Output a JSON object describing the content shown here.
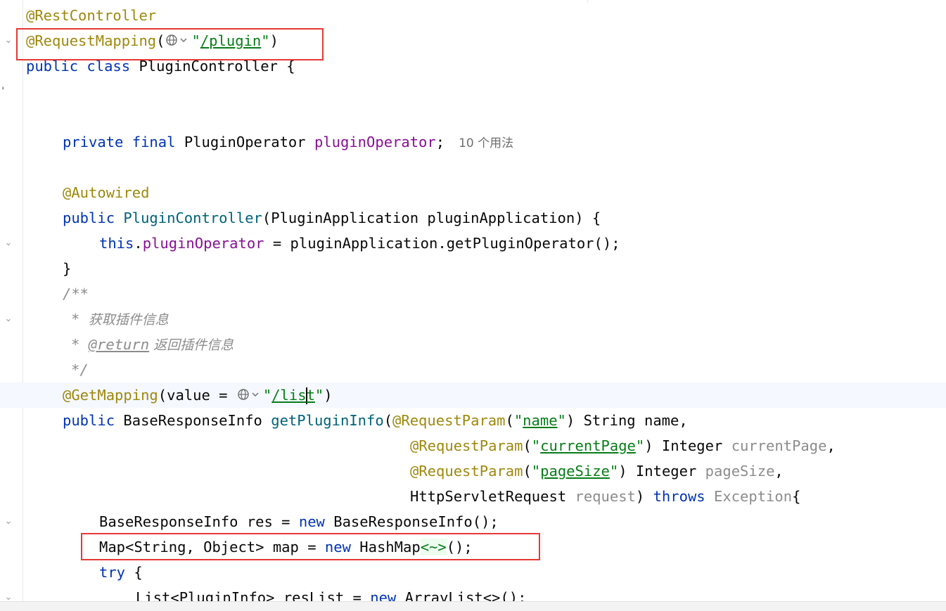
{
  "editor": {
    "inlay_hint_usages": "10 个用法",
    "lines": {
      "l1": {
        "ann": "@RestController"
      },
      "l2": {
        "ann": "@RequestMapping",
        "open": "(",
        "str_q1": "\"",
        "str_val": "/plugin",
        "str_q2": "\"",
        "close": ")"
      },
      "l3": {
        "kw1": "public",
        "kw2": "class",
        "name": "PluginController {"
      },
      "l6": {
        "kw1": "private",
        "kw2": "final",
        "type": "PluginOperator",
        "field": "pluginOperator",
        "semi": ";"
      },
      "l8": {
        "ann": "@Autowired"
      },
      "l9": {
        "kw": "public",
        "fn": "PluginController",
        "rest": "(PluginApplication pluginApplication) {"
      },
      "l10": {
        "kw": "this",
        "dot": ".",
        "field": "pluginOperator",
        "rest": " = pluginApplication.getPluginOperator();"
      },
      "l11": {
        "text": "}"
      },
      "l12": {
        "text": "/**"
      },
      "l13": {
        "star": "* ",
        "text": "获取插件信息"
      },
      "l14": {
        "star": "* ",
        "tag": "@return",
        "text": " 返回插件信息"
      },
      "l15": {
        "text": "*/"
      },
      "l16": {
        "ann": "@GetMapping",
        "open": "(value = ",
        "str_q1": "\"",
        "str_a": "/lis",
        "str_b": "t",
        "str_q2": "\"",
        "close": ")"
      },
      "l17": {
        "kw": "public",
        "type": "BaseResponseInfo",
        "fn": "getPluginInfo",
        "open": "(",
        "ann": "@RequestParam",
        "p1": "(",
        "q1": "\"",
        "sval": "name",
        "q2": "\"",
        "p2": ")",
        "rest": " String name,"
      },
      "l18": {
        "ann": "@RequestParam",
        "p1": "(",
        "q1": "\"",
        "sval": "currentPage",
        "q2": "\"",
        "p2": ")",
        "type": " Integer ",
        "param": "currentPage",
        "comma": ","
      },
      "l19": {
        "ann": "@RequestParam",
        "p1": "(",
        "q1": "\"",
        "sval": "pageSize",
        "q2": "\"",
        "p2": ")",
        "type": " Integer ",
        "param": "pageSize",
        "comma": ","
      },
      "l20": {
        "type": "HttpServletRequest ",
        "param": "request",
        "mid": ") ",
        "kw": "throws",
        "exc": " Exception",
        "brace": "{"
      },
      "l21": {
        "a": "BaseResponseInfo res = ",
        "kw": "new",
        "b": " BaseResponseInfo();"
      },
      "l22": {
        "a": "Map<String, Object> map = ",
        "kw": "new",
        "b": " HashMap",
        "diamond": "<~>",
        "c": "();"
      },
      "l23": {
        "kw": "try",
        "rest": " {"
      },
      "l24": {
        "a": "List<PluginInfo> resList = ",
        "kw": "new",
        "b": " ArrayList<>();"
      }
    }
  },
  "colors": {
    "keyword": "#0033b3",
    "annotation": "#9e880d",
    "string": "#067d17",
    "field": "#871094",
    "method": "#00627a",
    "comment": "#8c8c8c",
    "highlight_box": "#e53935"
  }
}
